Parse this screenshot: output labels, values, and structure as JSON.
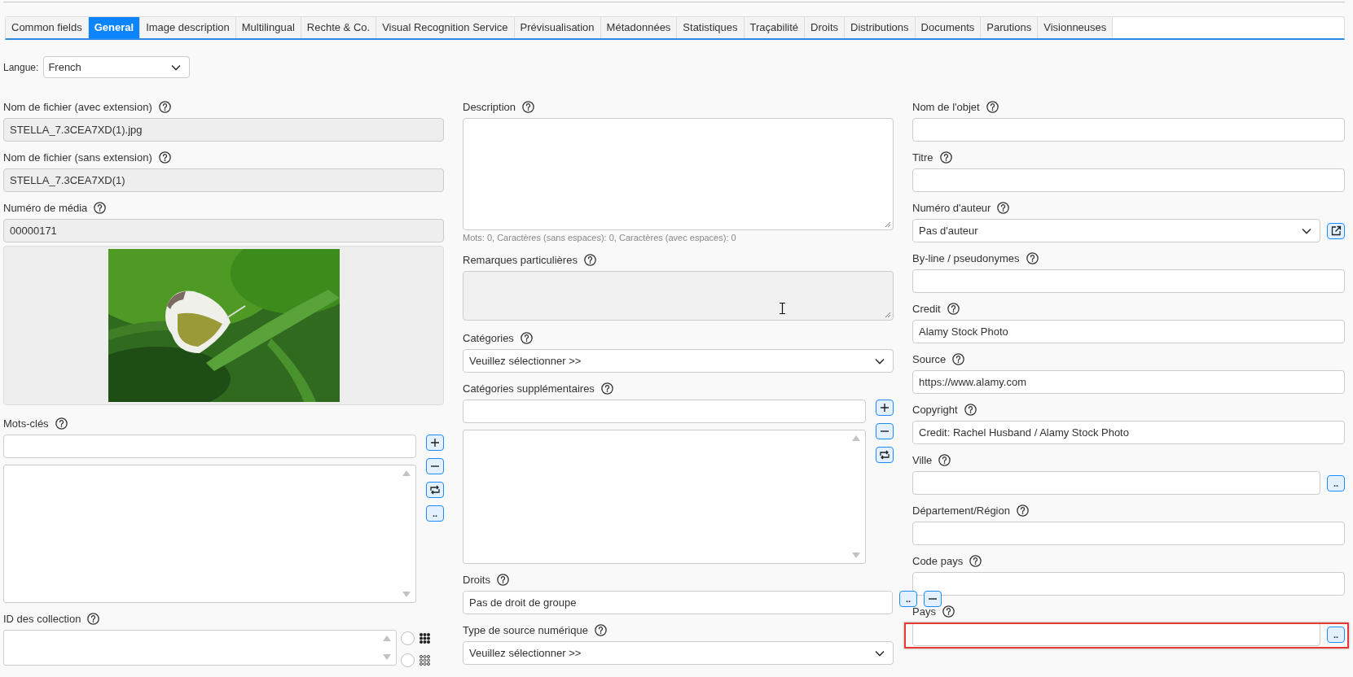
{
  "tabs": [
    {
      "label": "Common fields",
      "selected": false
    },
    {
      "label": "General",
      "selected": true
    },
    {
      "label": "Image description",
      "selected": false
    },
    {
      "label": "Multilingual",
      "selected": false
    },
    {
      "label": "Rechte & Co.",
      "selected": false
    },
    {
      "label": "Visual Recognition Service",
      "selected": false
    },
    {
      "label": "Prévisualisation",
      "selected": false
    },
    {
      "label": "Métadonnées",
      "selected": false
    },
    {
      "label": "Statistiques",
      "selected": false
    },
    {
      "label": "Traçabilité",
      "selected": false
    },
    {
      "label": "Droits",
      "selected": false
    },
    {
      "label": "Distributions",
      "selected": false
    },
    {
      "label": "Documents",
      "selected": false
    },
    {
      "label": "Parutions",
      "selected": false
    },
    {
      "label": "Visionneuses",
      "selected": false
    }
  ],
  "language": {
    "label": "Langue:",
    "value": "French"
  },
  "columns": [
    [
      {
        "kind": "input",
        "label": "Nom de fichier (avec extension)",
        "value": "STELLA_7.3CEA7XD(1).jpg",
        "readonly": true
      },
      {
        "kind": "input",
        "label": "Nom de fichier (sans extension)",
        "value": "STELLA_7.3CEA7XD(1)",
        "readonly": true
      },
      {
        "kind": "input",
        "label": "Numéro de média",
        "value": "00000171",
        "readonly": true
      },
      {
        "kind": "picture"
      },
      {
        "kind": "multilist",
        "label": "Mots-clés",
        "buttons": [
          {
            "kind": "add"
          },
          {
            "kind": "remove"
          },
          {
            "kind": "swap"
          },
          {
            "kind": "more",
            "text": ".."
          }
        ]
      },
      {
        "kind": "collection",
        "label": "ID des collection",
        "options": [
          {
            "kind": "grid-dense",
            "selected": false
          },
          {
            "kind": "grid-sparse",
            "selected": false
          }
        ]
      }
    ],
    [
      {
        "kind": "memo",
        "label": "Description",
        "readonly": false,
        "counter": "Mots: 0, Caractères (sans espaces): 0, Caractères (avec espaces): 0"
      },
      {
        "kind": "textarea",
        "label": "Remarques particulières",
        "readonly": true,
        "cursor": true
      },
      {
        "kind": "select",
        "label": "Catégories",
        "value": "Veuillez sélectionner >>"
      },
      {
        "kind": "multilist",
        "label": "Catégories supplémentaires",
        "buttons": [
          {
            "kind": "add"
          },
          {
            "kind": "remove"
          },
          {
            "kind": "swap"
          }
        ]
      },
      {
        "kind": "input",
        "label": "Droits",
        "value": "Pas de droit de groupe",
        "readonly": false,
        "buttons": [
          {
            "kind": "more",
            "text": ".."
          },
          {
            "kind": "remove"
          }
        ]
      },
      {
        "kind": "select",
        "label": "Type de source numérique",
        "value": "Veuillez sélectionner >>"
      }
    ],
    [
      {
        "kind": "input",
        "label": "Nom de l'objet",
        "readonly": false,
        "highlighted": false
      },
      {
        "kind": "input",
        "label": "Titre",
        "readonly": false,
        "highlighted": false
      },
      {
        "kind": "select",
        "label": "Numéro d'auteur",
        "value": "Pas d'auteur",
        "highlighted": false,
        "buttons": [
          {
            "kind": "external"
          }
        ]
      },
      {
        "kind": "input",
        "label": "By-line / pseudonymes",
        "readonly": false,
        "highlighted": false
      },
      {
        "kind": "input",
        "label": "Credit",
        "value": "Alamy Stock Photo",
        "readonly": false,
        "highlighted": false
      },
      {
        "kind": "input",
        "label": "Source",
        "value": "https://www.alamy.com",
        "readonly": false,
        "highlighted": false
      },
      {
        "kind": "input",
        "label": "Copyright",
        "value": "Credit: Rachel Husband / Alamy Stock Photo",
        "readonly": false,
        "highlighted": false
      },
      {
        "kind": "input",
        "label": "Ville",
        "readonly": false,
        "highlighted": false,
        "buttons": [
          {
            "kind": "more",
            "text": ".."
          }
        ]
      },
      {
        "kind": "input",
        "label": "Département/Région",
        "readonly": false,
        "highlighted": false
      },
      {
        "kind": "input",
        "label": "Code pays",
        "readonly": false,
        "highlighted": false
      },
      {
        "kind": "input",
        "label": "Pays",
        "readonly": false,
        "highlighted": true,
        "buttons": [
          {
            "kind": "more",
            "text": ".."
          }
        ]
      }
    ]
  ]
}
